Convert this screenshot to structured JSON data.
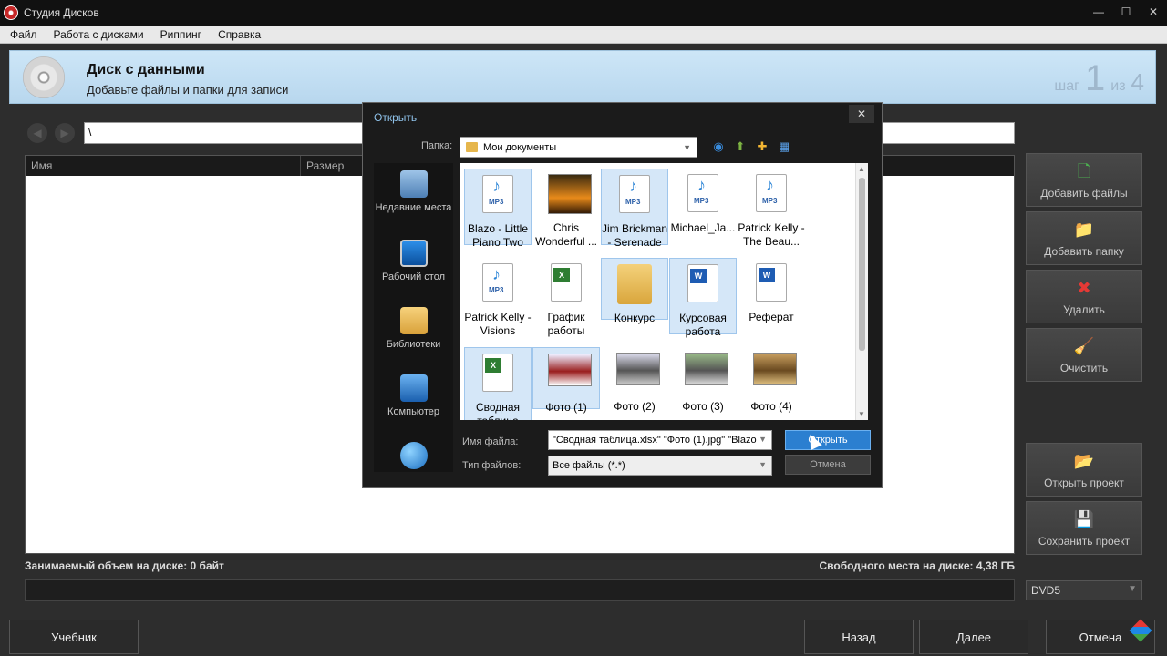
{
  "window": {
    "title": "Студия Дисков",
    "min": "—",
    "max": "☐",
    "close": "✕"
  },
  "menu": [
    "Файл",
    "Работа с дисками",
    "Риппинг",
    "Справка"
  ],
  "header": {
    "title": "Диск с данными",
    "subtitle": "Добавьте файлы и папки для записи",
    "step_word": "шаг",
    "step_current": "1",
    "step_of": "из",
    "step_total": "4"
  },
  "path": {
    "value": "\\"
  },
  "columns": [
    "Имя",
    "Размер"
  ],
  "status": {
    "used": "Занимаемый объем на диске: 0 байт",
    "free": "Свободного места на диске: 4,38 ГБ"
  },
  "disc_type": "DVD5",
  "side_buttons": {
    "add_files": "Добавить файлы",
    "add_folder": "Добавить папку",
    "delete": "Удалить",
    "clear": "Очистить",
    "open_project": "Открыть проект",
    "save_project": "Сохранить проект"
  },
  "bottom_buttons": {
    "tutorial": "Учебник",
    "back": "Назад",
    "next": "Далее",
    "cancel": "Отмена"
  },
  "dialog": {
    "title": "Открыть",
    "close": "✕",
    "folder_label": "Папка:",
    "folder": "Мои документы",
    "places": [
      "Недавние места",
      "Рабочий стол",
      "Библиотеки",
      "Компьютер"
    ],
    "items": [
      {
        "name": "Blazo - Little Piano Two",
        "kind": "mp3",
        "selected": true
      },
      {
        "name": "Chris Wonderful ...",
        "kind": "video",
        "selected": false
      },
      {
        "name": "Jim Brickman - Serenade",
        "kind": "mp3",
        "selected": true
      },
      {
        "name": "Michael_Ja...",
        "kind": "mp3",
        "selected": false
      },
      {
        "name": "Patrick Kelly - The Beau...",
        "kind": "mp3",
        "selected": false
      },
      {
        "name": "Patrick Kelly - Visions",
        "kind": "mp3",
        "selected": false
      },
      {
        "name": "График работы",
        "kind": "xlsx",
        "selected": false
      },
      {
        "name": "Конкурс",
        "kind": "folder",
        "selected": true
      },
      {
        "name": "Курсовая работа",
        "kind": "docx",
        "selected": true
      },
      {
        "name": "Реферат",
        "kind": "docx",
        "selected": false
      },
      {
        "name": "Сводная таблица",
        "kind": "xlsx",
        "selected": true
      },
      {
        "name": "Фото (1)",
        "kind": "photo",
        "selected": true
      },
      {
        "name": "Фото (2)",
        "kind": "photo",
        "selected": false
      },
      {
        "name": "Фото (3)",
        "kind": "photo",
        "selected": false
      },
      {
        "name": "Фото (4)",
        "kind": "photo",
        "selected": false
      }
    ],
    "filename_label": "Имя файла:",
    "filename_value": "\"Сводная таблица.xlsx\" \"Фото (1).jpg\" \"Blazo",
    "filetype_label": "Тип файлов:",
    "filetype_value": "Все файлы (*.*)",
    "open_button": "Открыть",
    "cancel_button": "Отмена",
    "mp3_badge": "MP3",
    "xl_badge": "X",
    "word_badge": "W"
  },
  "colors": {
    "accent": "#2b7fd0",
    "header_bg": "#cde6f7",
    "selection": "#d5e7f8"
  }
}
